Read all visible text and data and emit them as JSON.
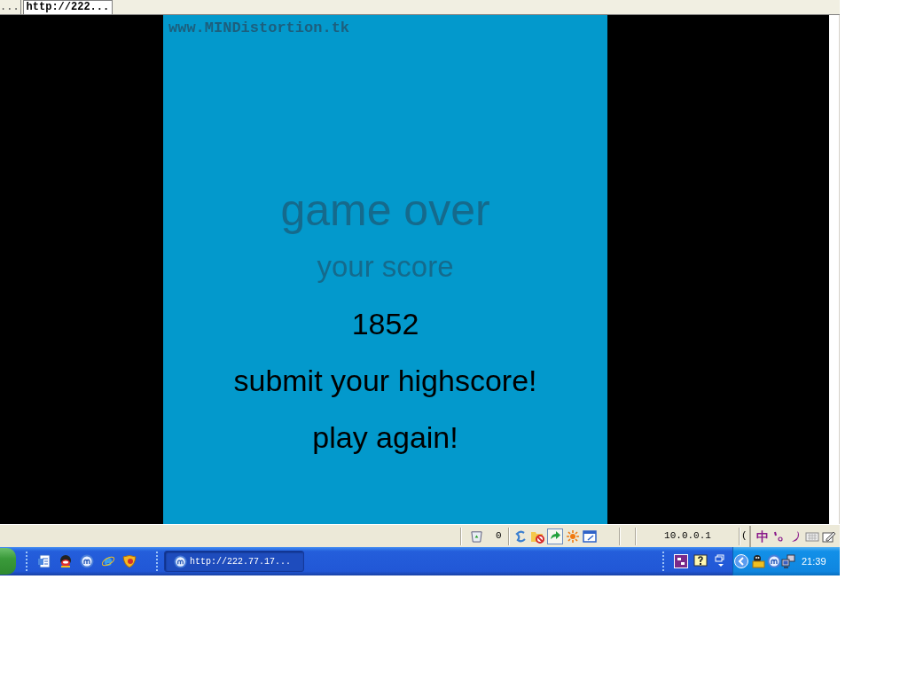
{
  "browser": {
    "tabs": [
      {
        "label": "...",
        "selected": false
      },
      {
        "label": "http://222...",
        "selected": true
      }
    ]
  },
  "game": {
    "site_label": "www.MINDistortion.tk",
    "title": "game over",
    "score_label": "your score",
    "score": "1852",
    "actions": [
      {
        "label": "submit your highscore!"
      },
      {
        "label": "play again!"
      }
    ]
  },
  "status_bar": {
    "count": "0",
    "ip_address": "10.0.0.1",
    "cut_text": "(",
    "ime_mode": "中"
  },
  "taskbar": {
    "tasks": [
      {
        "label": "http://222.77.17...",
        "selected": true
      }
    ],
    "clock": "21:39"
  }
}
